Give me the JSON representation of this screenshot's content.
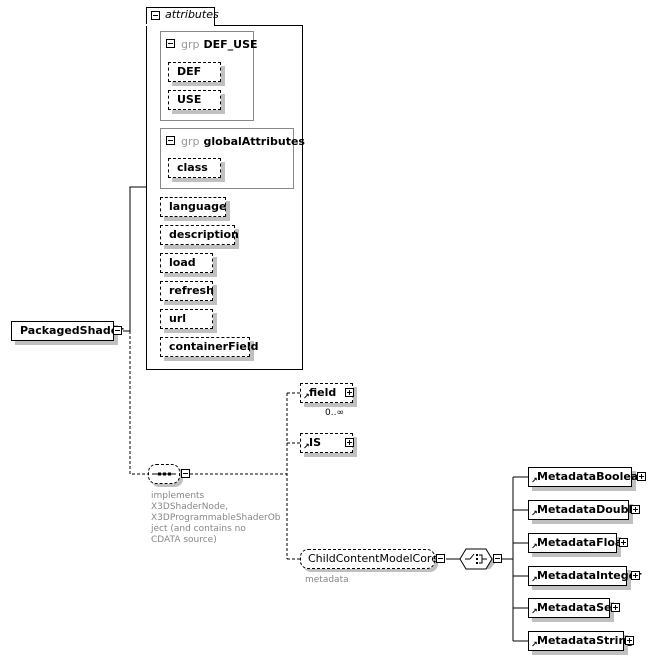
{
  "root": {
    "name": "PackagedShader"
  },
  "attributes_group": {
    "label": "attributes",
    "groups": [
      {
        "keyword": "grp",
        "name": "DEF_USE",
        "items": [
          "DEF",
          "USE"
        ]
      },
      {
        "keyword": "grp",
        "name": "globalAttributes",
        "items": [
          "class"
        ]
      }
    ],
    "items": [
      "language",
      "description",
      "load",
      "refresh",
      "url",
      "containerField"
    ]
  },
  "sequence": {
    "annotation": "implements X3DShaderNode, X3DProgrammableShaderObject (and contains no CDATA source)",
    "annotation_lines": [
      "implements",
      "X3DShaderNode,",
      "X3DProgrammableShaderOb",
      "ject (and contains no",
      "CDATA source)"
    ]
  },
  "children": {
    "field": {
      "name": "field",
      "cardinality": "0..∞"
    },
    "is": {
      "name": "IS"
    },
    "core": {
      "name": "ChildContentModelCore",
      "annotation": "metadata"
    }
  },
  "choice_items": [
    "MetadataBoolean",
    "MetadataDouble",
    "MetadataFloat",
    "MetadataInteger",
    "MetadataSet",
    "MetadataString"
  ]
}
